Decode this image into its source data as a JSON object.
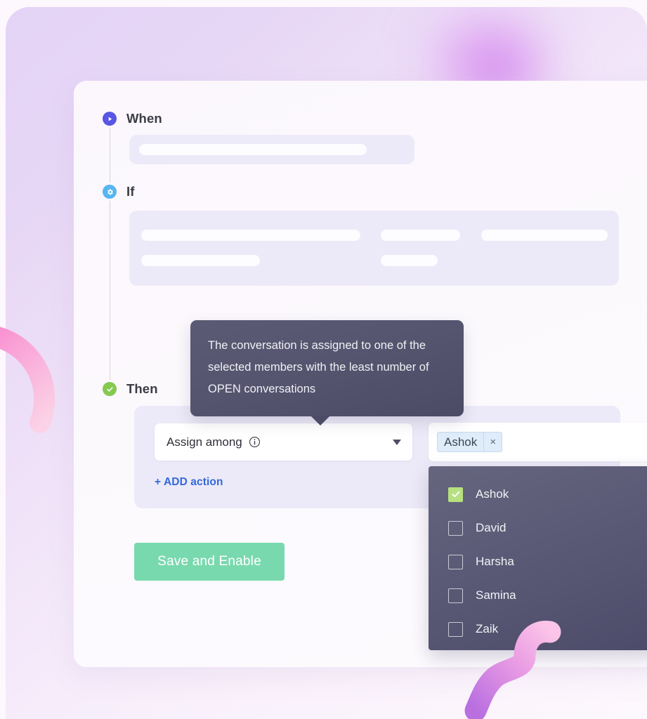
{
  "steps": [
    {
      "key": "when",
      "label": "When",
      "icon": "play-icon",
      "icon_color": "#5856e3"
    },
    {
      "key": "if",
      "label": "If",
      "icon": "gear-icon",
      "icon_color": "#56b6f0"
    },
    {
      "key": "then",
      "label": "Then",
      "icon": "check-circle-icon",
      "icon_color": "#85c94f"
    }
  ],
  "action": {
    "select_value": "Assign among",
    "info_icon": "info-icon",
    "caret_icon": "chevron-down-icon",
    "add_action_label": "+ ADD action"
  },
  "tooltip": {
    "text": "The conversation is assigned to one of the selected members with the least number of OPEN conversations"
  },
  "members_field": {
    "chips": [
      {
        "label": "Ashok",
        "remove_icon": "×"
      }
    ]
  },
  "members_dropdown": {
    "options": [
      {
        "label": "Ashok",
        "checked": true
      },
      {
        "label": "David",
        "checked": false
      },
      {
        "label": "Harsha",
        "checked": false
      },
      {
        "label": "Samina",
        "checked": false
      },
      {
        "label": "Zaik",
        "checked": false
      }
    ]
  },
  "footer": {
    "save_label": "Save and Enable"
  },
  "colors": {
    "accent_purple": "#5856e3",
    "accent_blue": "#56b6f0",
    "accent_green": "#85c94f",
    "link_blue": "#3368dd",
    "save_green": "#79d9ae",
    "checkbox_green": "#b7e07f",
    "skeleton_bg": "#eceaf8",
    "dropdown_bg": "#5c5b77"
  }
}
